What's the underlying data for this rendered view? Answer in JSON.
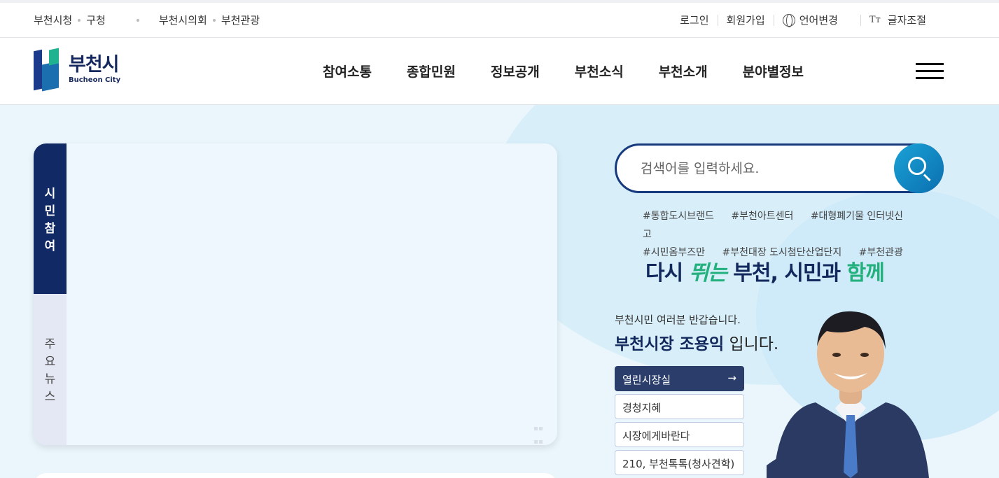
{
  "topbar": {
    "left_links": [
      "부천시청",
      "구청",
      "부천시의회",
      "부천관광"
    ],
    "login": "로그인",
    "join": "회원가입",
    "language": "언어변경",
    "font_size_icon": "Tт",
    "font_size": "글자조절"
  },
  "header": {
    "logo_ko": "부천시",
    "logo_en": "Bucheon City",
    "nav": [
      "참여소통",
      "종합민원",
      "정보공개",
      "부천소식",
      "부천소개",
      "분야별정보"
    ]
  },
  "panel": {
    "tab_active": "시\n민\n참\n여",
    "tab_inactive": "주\n요\n뉴\n스"
  },
  "search": {
    "placeholder": "검색어를 입력하세요.",
    "tags_row1": [
      "#통합도시브랜드",
      "#부천아트센터",
      "#대형폐기물 인터넷신고"
    ],
    "tags_row2": [
      "#시민옴부즈만",
      "#부천대장 도시첨단산업단지",
      "#부천관광"
    ]
  },
  "slogan": {
    "part1": "다시 ",
    "part2": "뛰는",
    "part3": " 부천, 시민과 ",
    "part4": "함께"
  },
  "mayor": {
    "greeting": "부천시민 여러분 반갑습니다.",
    "name": "부천시장 조용익",
    "suffix": " 입니다.",
    "buttons": [
      "열린시장실",
      "경청지혜",
      "시장에게바란다",
      "210, 부천톡톡(청사견학)"
    ],
    "arrow": "→"
  },
  "colors": {
    "navy": "#13295e",
    "accent_green": "#22b07d",
    "search_blue": "#0b6fb0"
  }
}
